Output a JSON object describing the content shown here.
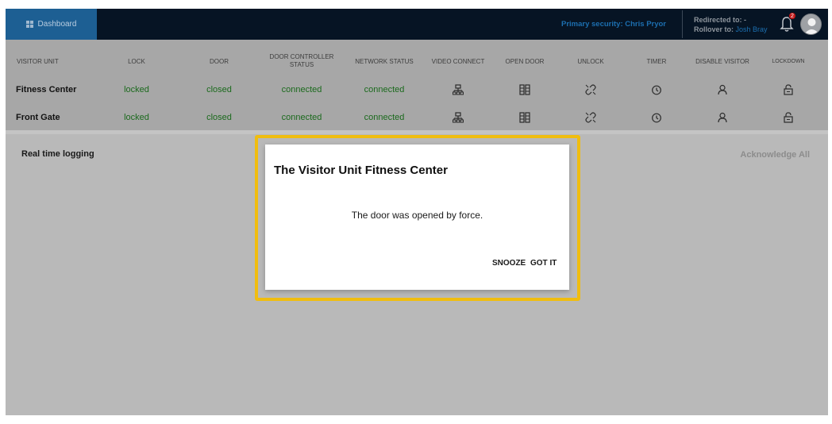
{
  "topbar": {
    "dashboard_label": "Dashboard",
    "primary_security_label": "Primary security:",
    "primary_security_name": "Chris Pryor",
    "redirected_label": "Redirected to:",
    "redirected_value": "-",
    "rollover_label": "Rollover to:",
    "rollover_name": "Josh Bray",
    "notification_count": "2"
  },
  "table": {
    "headers": {
      "visitor_unit": "VISITOR UNIT",
      "lock": "LOCK",
      "door": "DOOR",
      "door_controller_1": "DOOR CONTROLLER",
      "door_controller_2": "STATUS",
      "network_status": "NETWORK STATUS",
      "video_connect": "VIDEO CONNECT",
      "open_door": "OPEN DOOR",
      "unlock": "UNLOCK",
      "timer": "TIMER",
      "disable_visitor": "DISABLE VISITOR",
      "lockdown": "LOCKDOWN"
    },
    "rows": [
      {
        "name": "Fitness Center",
        "lock": "locked",
        "door": "closed",
        "controller": "connected",
        "network": "connected"
      },
      {
        "name": "Front Gate",
        "lock": "locked",
        "door": "closed",
        "controller": "connected",
        "network": "connected"
      }
    ]
  },
  "logging": {
    "title": "Real time logging",
    "acknowledge_all": "Acknowledge All"
  },
  "dialog": {
    "title": "The Visitor Unit Fitness Center",
    "message": "The door was opened by force.",
    "snooze": "SNOOZE",
    "got_it": "GOT IT"
  },
  "colors": {
    "topbar": "#061424",
    "dashboard_tab": "#1d5f93",
    "status_green": "#1b6a1d",
    "highlight": "#f0bd0f",
    "badge": "#c01818"
  },
  "icons": {
    "dashboard": "grid-icon",
    "notifications": "bell-icon",
    "user": "avatar",
    "video_connect": "network-icon",
    "open_door": "door-panels-icon",
    "unlock": "broken-link-icon",
    "timer": "clock-icon",
    "disable_visitor": "person-icon",
    "lockdown": "padlock-icon"
  }
}
